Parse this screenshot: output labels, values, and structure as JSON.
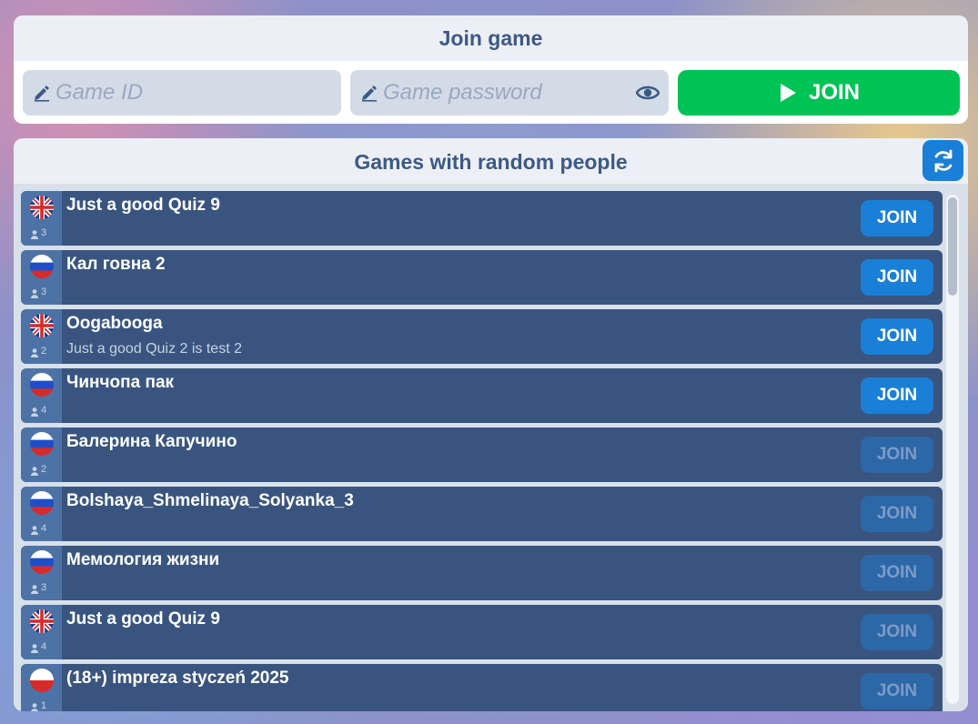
{
  "join_panel": {
    "title": "Join game",
    "game_id_placeholder": "Game ID",
    "password_placeholder": "Game password",
    "join_label": "JOIN",
    "join_color": "#00c356"
  },
  "list_panel": {
    "title": "Games with random people",
    "refresh_icon": "refresh-icon",
    "accent": "#1a7fd6"
  },
  "games": [
    {
      "flag": "uk",
      "name": "Just a good Quiz 9",
      "description": "",
      "players": "3",
      "join_label": "JOIN",
      "enabled": true
    },
    {
      "flag": "ru",
      "name": "Кал говна 2",
      "description": "",
      "players": "3",
      "join_label": "JOIN",
      "enabled": true
    },
    {
      "flag": "uk",
      "name": "Oogabooga",
      "description": "Just a good Quiz 2 is test 2",
      "players": "2",
      "join_label": "JOIN",
      "enabled": true
    },
    {
      "flag": "ru",
      "name": "Чинчопа пак",
      "description": "",
      "players": "4",
      "join_label": "JOIN",
      "enabled": true
    },
    {
      "flag": "ru",
      "name": "Балерина Капучино",
      "description": "",
      "players": "2",
      "join_label": "JOIN",
      "enabled": false
    },
    {
      "flag": "ru",
      "name": "Bolshaya_Shmelinaya_Solyanka_3",
      "description": "",
      "players": "4",
      "join_label": "JOIN",
      "enabled": false
    },
    {
      "flag": "ru",
      "name": "Мемология жизни",
      "description": "",
      "players": "3",
      "join_label": "JOIN",
      "enabled": false
    },
    {
      "flag": "uk",
      "name": "Just a good Quiz 9",
      "description": "",
      "players": "4",
      "join_label": "JOIN",
      "enabled": false
    },
    {
      "flag": "pl",
      "name": "(18+) impreza styczeń 2025",
      "description": "",
      "players": "1",
      "join_label": "JOIN",
      "enabled": false
    }
  ]
}
